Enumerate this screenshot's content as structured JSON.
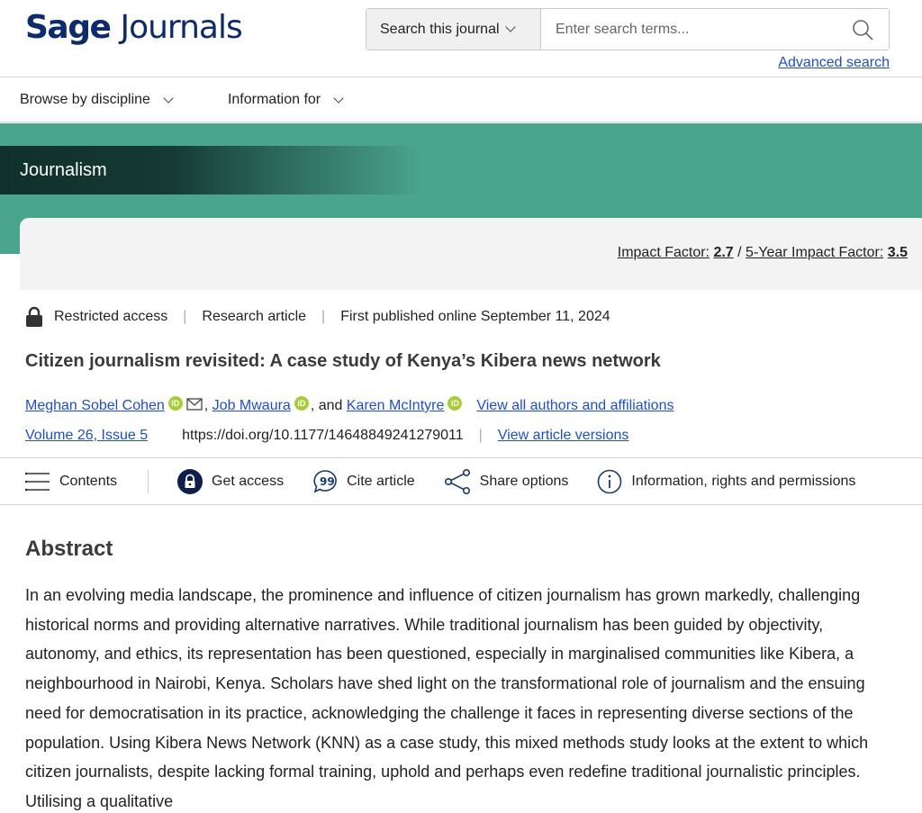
{
  "header": {
    "logo": {
      "word1": "Sage",
      "word2": "Journals"
    },
    "search_scope": "Search this journal",
    "search_placeholder": "Enter search terms...",
    "advanced_search": "Advanced search"
  },
  "nav": [
    {
      "label": "Browse by discipline"
    },
    {
      "label": "Information for"
    }
  ],
  "journal": {
    "name": "Journalism",
    "impact_factor_label": "Impact Factor:",
    "impact_factor": "2.7",
    "five_year_label": "5-Year Impact Factor:",
    "five_year_value": "3.5"
  },
  "article": {
    "access": "Restricted access",
    "type": "Research article",
    "published": "First published online September 11, 2024",
    "title": "Citizen journalism revisited: A case study of Kenya’s Kibera news network",
    "authors": {
      "a1": "Meghan Sobel Cohen",
      "a2": "Job Mwaura",
      "a3": "Karen McIntyre",
      "and": "and",
      "view_all": "View all authors and affiliations"
    },
    "volume": "Volume 26, Issue 5",
    "doi": "https://doi.org/10.1177/14648849241279011",
    "versions": "View article versions"
  },
  "toolbar": {
    "contents": "Contents",
    "get_access": "Get access",
    "cite": "Cite article",
    "share": "Share options",
    "info": "Information, rights and permissions"
  },
  "abstract": {
    "heading": "Abstract",
    "text": "In an evolving media landscape, the prominence and influence of citizen journalism has grown markedly, challenging historical norms and providing alternative narratives. While traditional journalism has been guided by objectivity, autonomy, and ethics, its representation has been questioned, especially in marginalised communities like Kibera, a neighbourhood in Nairobi, Kenya. Scholars have shed light on the transformational role of journalism and the ensuing need for democratisation in its practice, acknowledging the challenge it faces in representing diverse sections of the population. Using Kibera News Network (KNN) as a case study, this mixed methods study looks at the extent to which citizen journalists, despite lacking formal training, uphold and perhaps even redefine traditional journalistic principles. Utilising a qualitative"
  },
  "colors": {
    "brand_navy": "#0d2a6b",
    "banner_teal": "#4ba58c",
    "link_blue": "#1f4fc4",
    "orcid_green": "#a6ce39"
  }
}
